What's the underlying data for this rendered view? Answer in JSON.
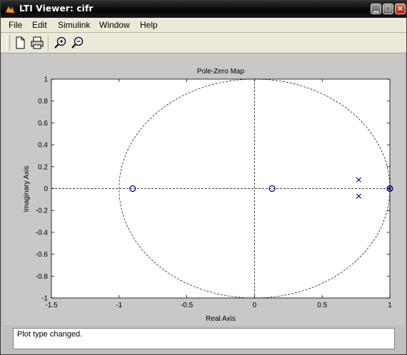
{
  "window": {
    "title": "LTI Viewer: cifr"
  },
  "menu": [
    "File",
    "Edit",
    "Simulink",
    "Window",
    "Help"
  ],
  "toolbar": {
    "icons": [
      "new-icon",
      "print-icon",
      "zoom-in-icon",
      "zoom-out-icon"
    ]
  },
  "plot": {
    "title": "Pole-Zero Map",
    "xlabel": "Real Axis",
    "ylabel": "Imaginary Axis"
  },
  "chart_data": {
    "type": "scatter",
    "title": "Pole-Zero Map",
    "xlabel": "Real Axis",
    "ylabel": "Imaginary Axis",
    "xlim": [
      -1.5,
      1
    ],
    "ylim": [
      -1,
      1
    ],
    "xticks": [
      -1.5,
      -1,
      -0.5,
      0,
      0.5,
      1
    ],
    "yticks": [
      -1,
      -0.8,
      -0.6,
      -0.4,
      -0.2,
      0,
      0.2,
      0.4,
      0.6,
      0.8,
      1
    ],
    "xtick_labels": [
      "-1.5",
      "-1",
      "-0.5",
      "0",
      "0.5",
      "1"
    ],
    "ytick_labels": [
      "-1",
      "-0.8",
      "-0.6",
      "-0.4",
      "-0.2",
      "0",
      "0.2",
      "0.4",
      "0.6",
      "0.8",
      "1"
    ],
    "grid": false,
    "unit_circle": true,
    "zeros": [
      {
        "re": -0.9,
        "im": 0
      },
      {
        "re": 0.13,
        "im": 0
      },
      {
        "re": 1.0,
        "im": 0
      }
    ],
    "poles": [
      {
        "re": 0.77,
        "im": 0.08
      },
      {
        "re": 0.77,
        "im": -0.07
      },
      {
        "re": 1.0,
        "im": 0
      }
    ],
    "marker_color": "#00008b"
  },
  "status": {
    "text": "Plot type changed."
  }
}
